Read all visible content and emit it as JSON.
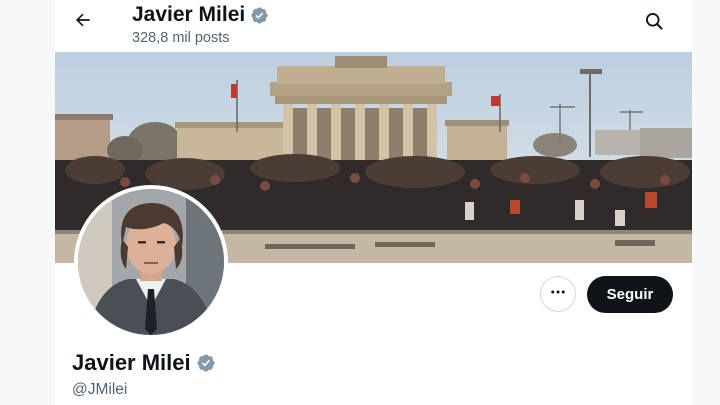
{
  "header": {
    "name": "Javier Milei",
    "posts_count": "328,8 mil posts"
  },
  "profile": {
    "name": "Javier Milei",
    "handle": "@JMilei",
    "verified": true,
    "badge_color": "#829aab"
  },
  "actions": {
    "follow_label": "Seguir",
    "follow_bg": "#0f1419",
    "more_icon": "more-horizontal-icon"
  },
  "icons": {
    "back": "arrow-left-icon",
    "search": "search-icon",
    "verified": "verified-badge-icon"
  }
}
